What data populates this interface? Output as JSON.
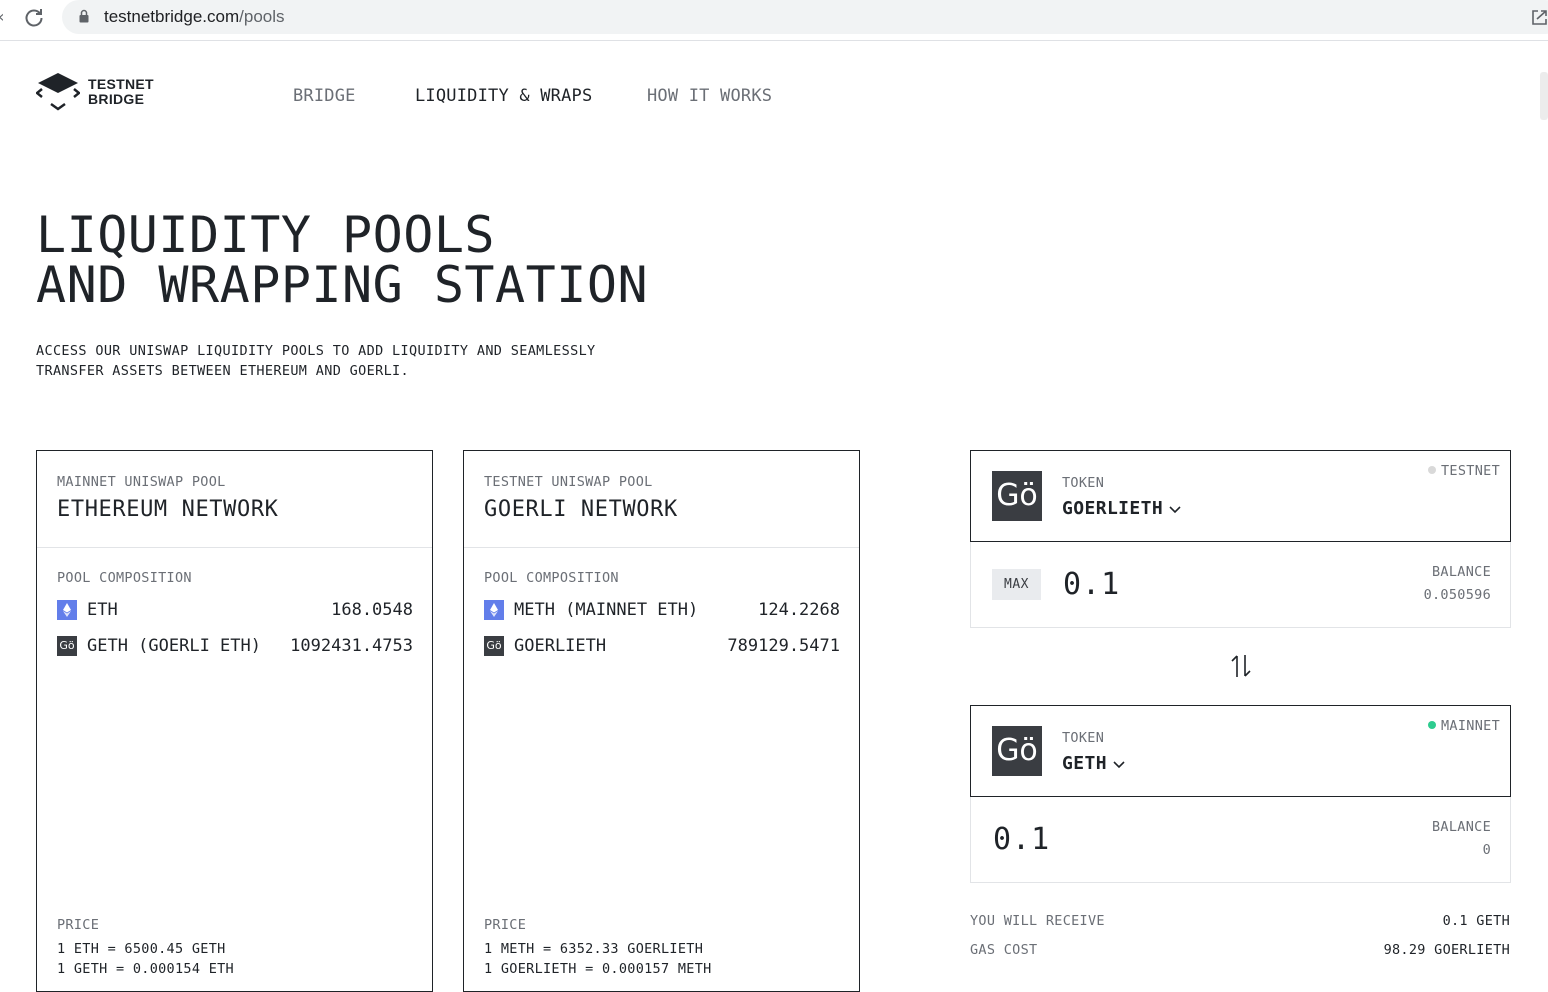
{
  "browser": {
    "url_domain": "testnetbridge.com",
    "url_path": "/pools"
  },
  "header": {
    "logo_line1": "TESTNET",
    "logo_line2": "BRIDGE",
    "nav": [
      "BRIDGE",
      "LIQUIDITY & WRAPS",
      "HOW IT WORKS"
    ],
    "active_nav": "LIQUIDITY & WRAPS"
  },
  "hero": {
    "title_line1": "LIQUIDITY POOLS",
    "title_line2": "AND WRAPPING STATION",
    "subtitle_line1": "ACCESS OUR UNISWAP LIQUIDITY POOLS TO ADD LIQUIDITY AND SEAMLESSLY",
    "subtitle_line2": "TRANSFER ASSETS BETWEEN ETHEREUM AND GOERLI."
  },
  "pools": [
    {
      "kicker": "MAINNET UNISWAP POOL",
      "title": "ETHEREUM NETWORK",
      "composition_label": "POOL COMPOSITION",
      "assets": [
        {
          "icon": "ethereum-icon",
          "name": "ETH",
          "amount": "168.0548"
        },
        {
          "icon": "goerli-icon",
          "name": "GETH (GOERLI ETH)",
          "amount": "1092431.4753"
        }
      ],
      "price_label": "PRICE",
      "prices": [
        "1 ETH = 6500.45 GETH",
        "1 GETH = 0.000154 ETH"
      ]
    },
    {
      "kicker": "TESTNET UNISWAP POOL",
      "title": "GOERLI NETWORK",
      "composition_label": "POOL COMPOSITION",
      "assets": [
        {
          "icon": "ethereum-icon",
          "name": "METH (MAINNET ETH)",
          "amount": "124.2268"
        },
        {
          "icon": "goerli-icon",
          "name": "GOERLIETH",
          "amount": "789129.5471"
        }
      ],
      "price_label": "PRICE",
      "prices": [
        "1 METH = 6352.33 GOERLIETH",
        "1 GOERLIETH = 0.000157 METH"
      ]
    }
  ],
  "swap": {
    "token_logo_text": "Gö",
    "from": {
      "token_label": "TOKEN",
      "token": "GOERLIETH",
      "network": "TESTNET",
      "network_color": "#d9d9d9",
      "max_label": "MAX",
      "amount": "0.1",
      "balance_label": "BALANCE",
      "balance": "0.050596"
    },
    "to": {
      "token_label": "TOKEN",
      "token": "GETH",
      "network": "MAINNET",
      "network_color": "#2ecc8f",
      "amount": "0.1",
      "balance_label": "BALANCE",
      "balance": "0"
    },
    "receive_label": "YOU WILL RECEIVE",
    "receive_value": "0.1 GETH",
    "gas_label": "GAS COST",
    "gas_value": "98.29 GOERLIETH"
  },
  "colors": {
    "ethereum_icon": "#627eea",
    "goerli_icon": "#3a3d42",
    "text": "#1f2328",
    "muted": "#6b6f76"
  }
}
